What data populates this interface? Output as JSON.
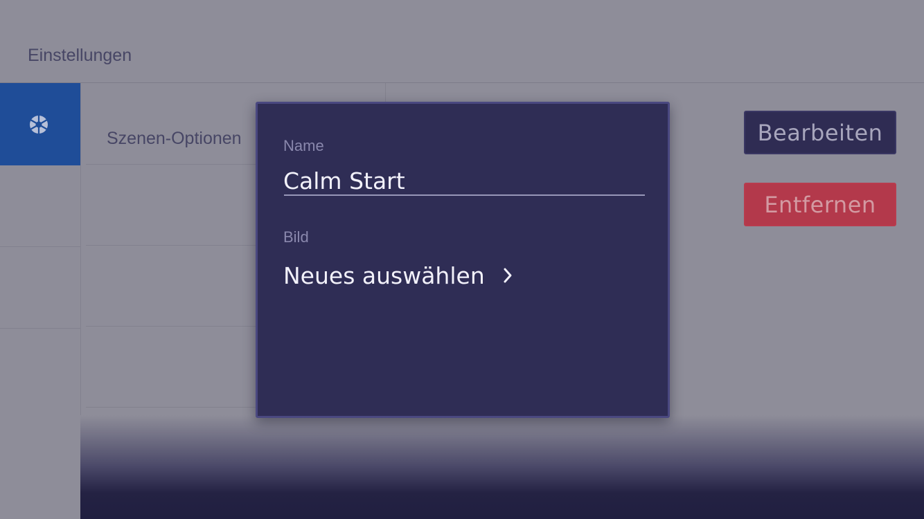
{
  "header": {
    "title": "Einstellungen"
  },
  "sidebar": {
    "active_icon": "aperture-icon"
  },
  "list": {
    "items": [
      "Szenen-Optionen"
    ]
  },
  "actions": {
    "edit_label": "Bearbeiten",
    "remove_label": "Entfernen"
  },
  "dialog": {
    "name_label": "Name",
    "name_value": "Calm Start",
    "image_label": "Bild",
    "choose_label": "Neues auswählen",
    "choose_icon": "chevron-right-icon"
  },
  "colors": {
    "overlay": "#8e8d99",
    "dialog_bg": "#2f2d55",
    "sidebar_active": "#1f4d98",
    "remove_button": "#b3394b"
  }
}
